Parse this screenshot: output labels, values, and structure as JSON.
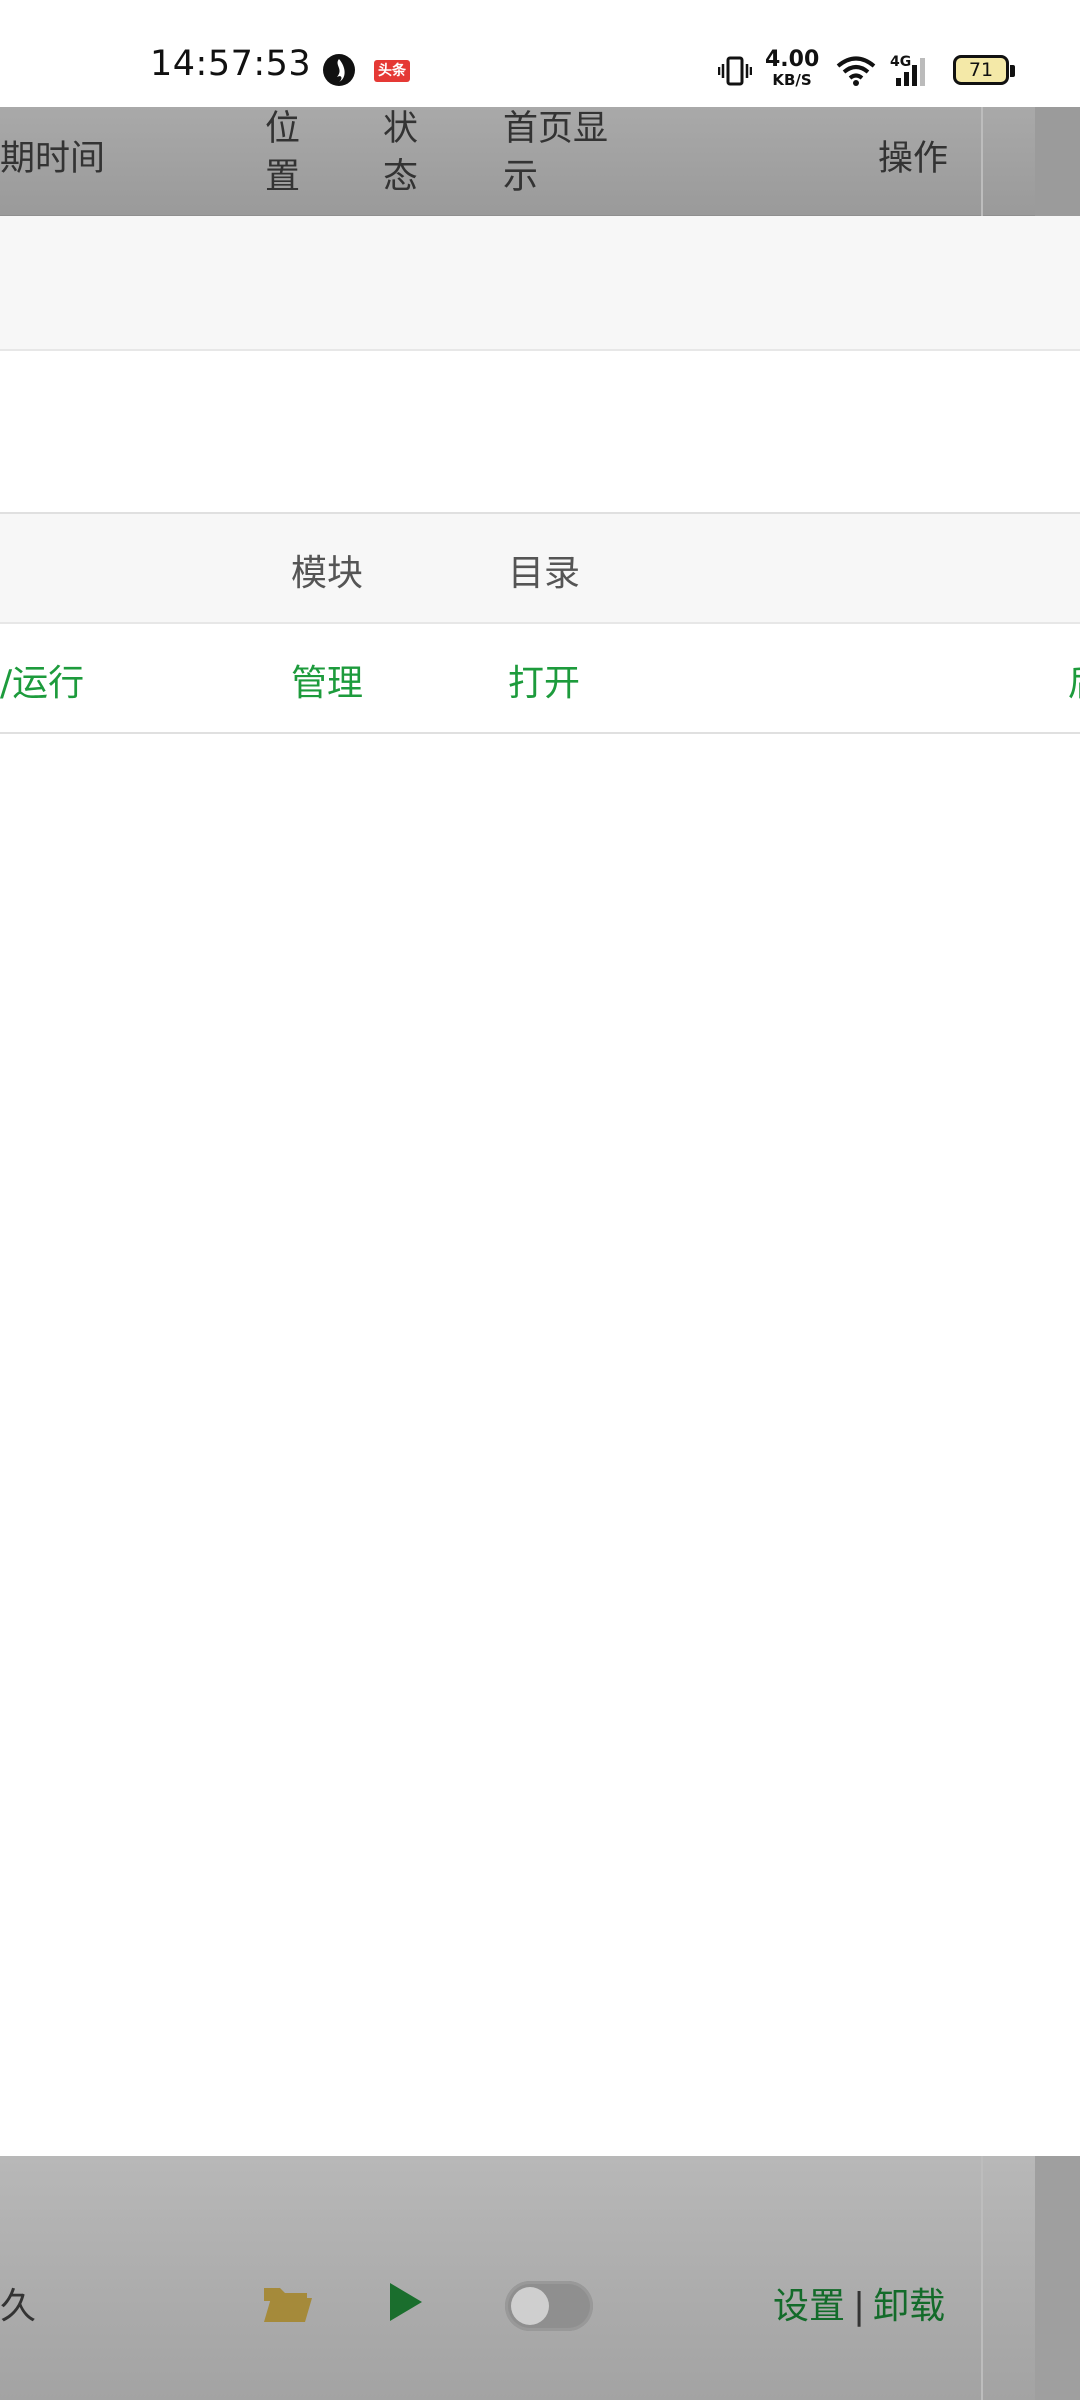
{
  "status_bar": {
    "time": "14:57:53",
    "left_icons": [
      "app-notification-icon",
      "toutiao-icon"
    ],
    "toutiao_label": "头条",
    "net_speed_value": "4.00",
    "net_speed_unit": "KB/S",
    "network_type": "4G",
    "battery_level": "71",
    "right_icons": [
      "vibrate-icon",
      "wifi-icon",
      "signal-icon",
      "battery-icon"
    ]
  },
  "table_header": {
    "col_time": "期时间",
    "col_position_line1": "位",
    "col_position_line2": "置",
    "col_status_line1": "状",
    "col_status_line2": "态",
    "col_homepage_line1": "首页显",
    "col_homepage_line2": "示",
    "col_actions": "操作"
  },
  "rows": {
    "label_row": {
      "module": "模块",
      "directory": "目录"
    },
    "action_row": {
      "run": "/运行",
      "manage": "管理",
      "open": "打开",
      "right_clipped": "后"
    }
  },
  "footer": {
    "left_text": "久",
    "settings": "设置",
    "separator": "|",
    "uninstall": "卸载",
    "toggle_on": false
  },
  "colors": {
    "action_green": "#1d9b3c",
    "footer_link_green": "#136b2a",
    "folder_gold": "#a58a3a",
    "play_green": "#1a6e2d"
  }
}
